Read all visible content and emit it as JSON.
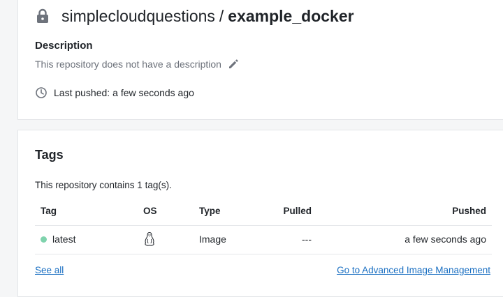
{
  "repository": {
    "owner": "simplecloudquestions",
    "separator": "/",
    "name": "example_docker",
    "description_title": "Description",
    "description_text": "This repository does not have a description",
    "last_pushed_label": "Last pushed:",
    "last_pushed_value": "a few seconds ago"
  },
  "tags": {
    "title": "Tags",
    "count_text": "This repository contains 1 tag(s).",
    "headers": {
      "tag": "Tag",
      "os": "OS",
      "type": "Type",
      "pulled": "Pulled",
      "pushed": "Pushed"
    },
    "rows": [
      {
        "tag": "latest",
        "os_icon": "linux-icon",
        "type": "Image",
        "pulled": "---",
        "pushed": "a few seconds ago",
        "status_color": "#7fd3ad"
      }
    ],
    "see_all_label": "See all",
    "advanced_link_label": "Go to Advanced Image Management"
  },
  "icons": {
    "lock": "lock-icon",
    "edit": "pencil-icon",
    "clock": "clock-icon"
  },
  "colors": {
    "link": "#1a6fc2",
    "muted_text": "#6b7079",
    "status_active": "#7fd3ad"
  }
}
